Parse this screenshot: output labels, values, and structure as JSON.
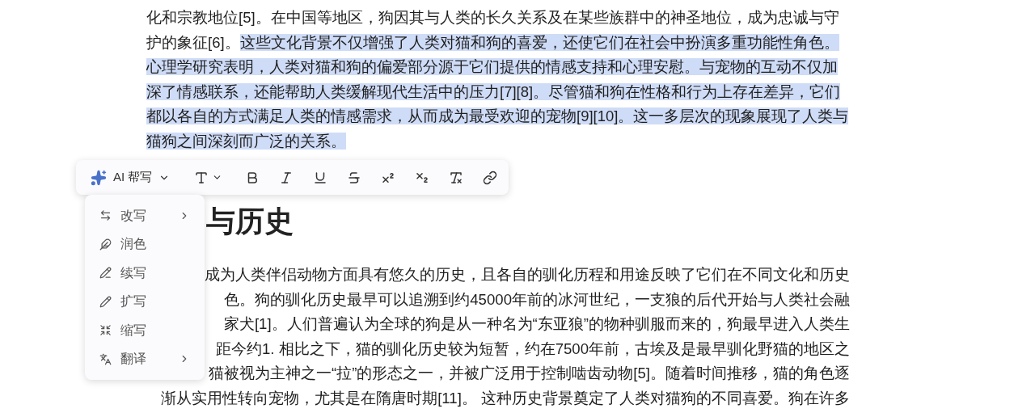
{
  "selected_paragraph": {
    "segments": [
      {
        "text": "化和宗教地位[5]。在中国等地区，狗因其与人类的长久关系及在某些族群中的神圣地位，成为忠诚与守护的象征[6]。",
        "selected": false
      },
      {
        "text": "这些文化背景不仅增强了人类对猫和狗的喜爱，还使它们在社会中扮演多重功能性角色。心理学研究表明，人类对猫和狗的偏爱部分源于它们提供的情感支持和心理安慰。与宠物的互动不仅加深了情感联系，还能帮助人类缓解现代生活中的压力[7][8]。尽管猫和狗在性格和行为上存在差异，它们都以各自的方式满足人类的情感需求，从而成为最受欢迎的宠物[9][10]。这一多层次的现象展现了人类与猫狗之间深刻而广泛的关系。",
        "selected": true
      }
    ]
  },
  "heading": "与历史",
  "body_lines": [
    "成为人类伴侣动物方面具有悠久的历史，且各自的驯化历程和用途反映了它们在不同文化和历史",
    "色。狗的驯化历史最早可以追溯到约45000年前的冰河世纪，一支狼的后代开始与人类社会融",
    "家犬[1]。人们普遍认为全球的狗是从一种名为“东亚狼”的物种驯服而来的，狗最早进入人类生",
    "距今约1. 相比之下，猫的驯化历史较为短暂，约在7500年前，古埃及是最早驯化野猫的地区之",
    "猫被视为主神之一“拉”的形态之一，并被广泛用于控制啮齿动物[5]。随着时间推移，猫的角色逐",
    "渐从实用性转向宠物，尤其是在隋唐时期[11]。 这种历史背景奠定了人类对猫狗的不同喜爱。狗在许多"
  ],
  "toolbar": {
    "ai_label": "AI 帮写",
    "tools": [
      {
        "kind": "type"
      },
      {
        "kind": "bold"
      },
      {
        "kind": "italic"
      },
      {
        "kind": "underline"
      },
      {
        "kind": "strike"
      },
      {
        "kind": "superscript"
      },
      {
        "kind": "subscript"
      },
      {
        "kind": "clear"
      },
      {
        "kind": "link"
      }
    ]
  },
  "ai_menu": [
    {
      "kind": "rewrite",
      "label": "改写",
      "submenu": true
    },
    {
      "kind": "polish",
      "label": "润色",
      "submenu": false
    },
    {
      "kind": "continue",
      "label": "续写",
      "submenu": false
    },
    {
      "kind": "expand",
      "label": "扩写",
      "submenu": false
    },
    {
      "kind": "shrink",
      "label": "缩写",
      "submenu": false
    },
    {
      "kind": "translate",
      "label": "翻译",
      "submenu": true
    }
  ]
}
